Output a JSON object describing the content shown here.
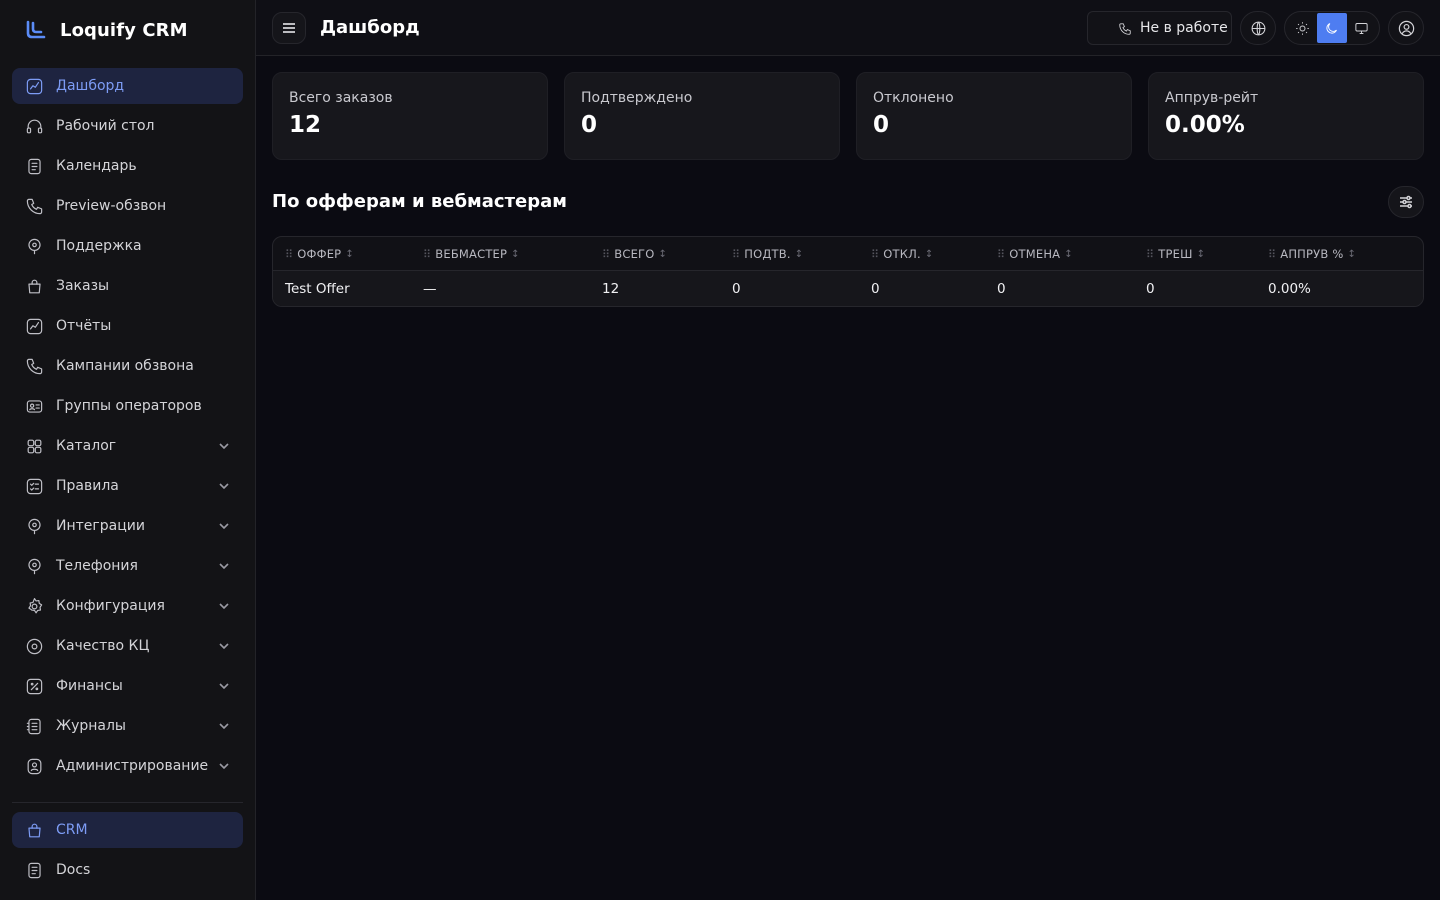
{
  "app": {
    "name": "Loquify CRM",
    "brand_color": "#5b8cf7"
  },
  "sidebar": {
    "items": [
      {
        "label": "Дашборд",
        "icon": "chart-line-icon",
        "active": true,
        "expandable": false
      },
      {
        "label": "Рабочий стол",
        "icon": "headset-icon",
        "active": false,
        "expandable": false
      },
      {
        "label": "Календарь",
        "icon": "document-icon",
        "active": false,
        "expandable": false
      },
      {
        "label": "Preview-обзвон",
        "icon": "phone-icon",
        "active": false,
        "expandable": false
      },
      {
        "label": "Поддержка",
        "icon": "location-pin-icon",
        "active": false,
        "expandable": false
      },
      {
        "label": "Заказы",
        "icon": "shopping-bag-icon",
        "active": false,
        "expandable": false
      },
      {
        "label": "Отчёты",
        "icon": "chart-line-icon",
        "active": false,
        "expandable": false
      },
      {
        "label": "Кампании обзвона",
        "icon": "phone-icon",
        "active": false,
        "expandable": false
      },
      {
        "label": "Группы операторов",
        "icon": "id-card-icon",
        "active": false,
        "expandable": false
      },
      {
        "label": "Каталог",
        "icon": "grid-icon",
        "active": false,
        "expandable": true
      },
      {
        "label": "Правила",
        "icon": "checklist-icon",
        "active": false,
        "expandable": true
      },
      {
        "label": "Интеграции",
        "icon": "location-pin-icon",
        "active": false,
        "expandable": true
      },
      {
        "label": "Телефония",
        "icon": "location-pin-icon",
        "active": false,
        "expandable": true
      },
      {
        "label": "Конфигурация",
        "icon": "gear-icon",
        "active": false,
        "expandable": true
      },
      {
        "label": "Качество КЦ",
        "icon": "eye-icon",
        "active": false,
        "expandable": true
      },
      {
        "label": "Финансы",
        "icon": "percent-icon",
        "active": false,
        "expandable": true
      },
      {
        "label": "Журналы",
        "icon": "journal-icon",
        "active": false,
        "expandable": true
      },
      {
        "label": "Администрирование",
        "icon": "user-shield-icon",
        "active": false,
        "expandable": true
      }
    ],
    "bottom_items": [
      {
        "label": "CRM",
        "icon": "shopping-bag-icon",
        "active": true
      },
      {
        "label": "Docs",
        "icon": "document-icon",
        "active": false
      }
    ]
  },
  "header": {
    "title": "Дашборд",
    "status_label": "Не в работе",
    "theme_active": "dark"
  },
  "stats": [
    {
      "label": "Всего заказов",
      "value": "12"
    },
    {
      "label": "Подтверждено",
      "value": "0"
    },
    {
      "label": "Отклонено",
      "value": "0"
    },
    {
      "label": "Аппрув-рейт",
      "value": "0.00%"
    }
  ],
  "section": {
    "title": "По офферам и вебмастерам"
  },
  "table": {
    "columns": [
      "ОФФЕР",
      "ВЕБМАСТЕР",
      "ВСЕГО",
      "ПОДТВ.",
      "ОТКЛ.",
      "ОТМЕНА",
      "ТРЕШ",
      "АППРУВ %"
    ],
    "rows": [
      [
        "Test Offer",
        "—",
        "12",
        "0",
        "0",
        "0",
        "0",
        "0.00%"
      ]
    ]
  }
}
